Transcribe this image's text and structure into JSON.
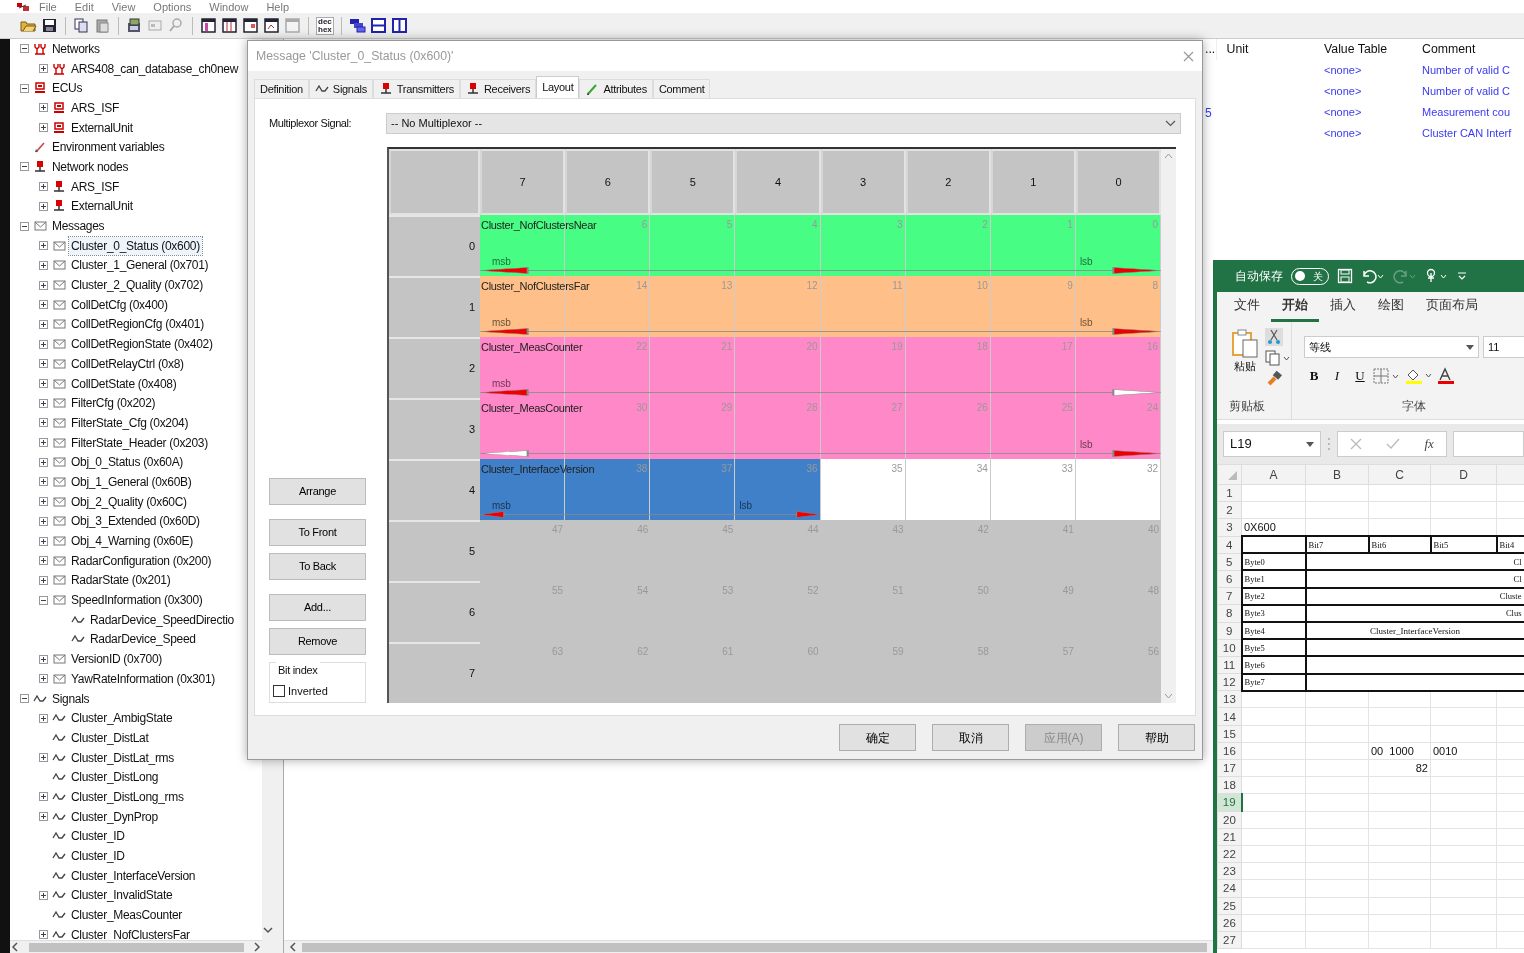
{
  "menu": [
    "File",
    "Edit",
    "View",
    "Options",
    "Window",
    "Help"
  ],
  "toolbar": {
    "format_toggle": [
      "dec",
      "hex"
    ]
  },
  "tree": [
    {
      "label": "Networks",
      "kind": "network",
      "expanded": true,
      "selected": false,
      "children": [
        {
          "label": "ARS408_can_database_ch0new",
          "kind": "network",
          "expanded": false,
          "selected": false
        }
      ]
    },
    {
      "label": "ECUs",
      "kind": "ecu",
      "expanded": true,
      "selected": false,
      "children": [
        {
          "label": "ARS_ISF",
          "kind": "ecu",
          "expanded": false,
          "selected": false
        },
        {
          "label": "ExternalUnit",
          "kind": "ecu",
          "expanded": false,
          "selected": false
        }
      ]
    },
    {
      "label": "Environment variables",
      "kind": "env",
      "selected": false
    },
    {
      "label": "Network nodes",
      "kind": "node",
      "expanded": true,
      "selected": false,
      "children": [
        {
          "label": "ARS_ISF",
          "kind": "node",
          "expanded": false,
          "selected": false
        },
        {
          "label": "ExternalUnit",
          "kind": "node",
          "expanded": false,
          "selected": false
        }
      ]
    },
    {
      "label": "Messages",
      "kind": "message",
      "expanded": true,
      "selected": false,
      "children": [
        {
          "label": "Cluster_0_Status (0x600)",
          "kind": "message",
          "expanded": false,
          "selected": true
        },
        {
          "label": "Cluster_1_General (0x701)",
          "kind": "message",
          "expanded": false,
          "selected": false
        },
        {
          "label": "Cluster_2_Quality (0x702)",
          "kind": "message",
          "expanded": false,
          "selected": false
        },
        {
          "label": "CollDetCfg (0x400)",
          "kind": "message",
          "expanded": false,
          "selected": false
        },
        {
          "label": "CollDetRegionCfg (0x401)",
          "kind": "message",
          "expanded": false,
          "selected": false
        },
        {
          "label": "CollDetRegionState (0x402)",
          "kind": "message",
          "expanded": false,
          "selected": false
        },
        {
          "label": "CollDetRelayCtrl (0x8)",
          "kind": "message",
          "expanded": false,
          "selected": false
        },
        {
          "label": "CollDetState (0x408)",
          "kind": "message",
          "expanded": false,
          "selected": false
        },
        {
          "label": "FilterCfg (0x202)",
          "kind": "message",
          "expanded": false,
          "selected": false
        },
        {
          "label": "FilterState_Cfg (0x204)",
          "kind": "message",
          "expanded": false,
          "selected": false
        },
        {
          "label": "FilterState_Header (0x203)",
          "kind": "message",
          "expanded": false,
          "selected": false
        },
        {
          "label": "Obj_0_Status (0x60A)",
          "kind": "message",
          "expanded": false,
          "selected": false
        },
        {
          "label": "Obj_1_General (0x60B)",
          "kind": "message",
          "expanded": false,
          "selected": false
        },
        {
          "label": "Obj_2_Quality (0x60C)",
          "kind": "message",
          "expanded": false,
          "selected": false
        },
        {
          "label": "Obj_3_Extended (0x60D)",
          "kind": "message",
          "expanded": false,
          "selected": false
        },
        {
          "label": "Obj_4_Warning (0x60E)",
          "kind": "message",
          "expanded": false,
          "selected": false
        },
        {
          "label": "RadarConfiguration (0x200)",
          "kind": "message",
          "expanded": false,
          "selected": false
        },
        {
          "label": "RadarState (0x201)",
          "kind": "message",
          "expanded": false,
          "selected": false
        },
        {
          "label": "SpeedInformation (0x300)",
          "kind": "message",
          "expanded": true,
          "selected": false,
          "children": [
            {
              "label": "RadarDevice_SpeedDirectio",
              "kind": "signal",
              "selected": false
            },
            {
              "label": "RadarDevice_Speed",
              "kind": "signal",
              "selected": false
            }
          ]
        },
        {
          "label": "VersionID (0x700)",
          "kind": "message",
          "expanded": false,
          "selected": false
        },
        {
          "label": "YawRateInformation (0x301)",
          "kind": "message",
          "expanded": false,
          "selected": false
        }
      ]
    },
    {
      "label": "Signals",
      "kind": "signal",
      "expanded": true,
      "selected": false,
      "children": [
        {
          "label": "Cluster_AmbigState",
          "kind": "signal",
          "expanded": false,
          "selected": false
        },
        {
          "label": "Cluster_DistLat",
          "kind": "signal",
          "selected": false
        },
        {
          "label": "Cluster_DistLat_rms",
          "kind": "signal",
          "expanded": false,
          "selected": false
        },
        {
          "label": "Cluster_DistLong",
          "kind": "signal",
          "selected": false
        },
        {
          "label": "Cluster_DistLong_rms",
          "kind": "signal",
          "expanded": false,
          "selected": false
        },
        {
          "label": "Cluster_DynProp",
          "kind": "signal",
          "expanded": false,
          "selected": false
        },
        {
          "label": "Cluster_ID",
          "kind": "signal",
          "selected": false
        },
        {
          "label": "Cluster_ID",
          "kind": "signal",
          "selected": false
        },
        {
          "label": "Cluster_InterfaceVersion",
          "kind": "signal",
          "selected": false
        },
        {
          "label": "Cluster_InvalidState",
          "kind": "signal",
          "expanded": false,
          "selected": false
        },
        {
          "label": "Cluster_MeasCounter",
          "kind": "signal",
          "selected": false
        },
        {
          "label": "Cluster_NofClustersFar",
          "kind": "signal",
          "expanded": false,
          "selected": false
        }
      ]
    }
  ],
  "signal_list": {
    "columns": [
      "...",
      "Unit",
      "Value Table",
      "Comment"
    ],
    "rows": [
      {
        "value_table": "<none>",
        "comment": "Number of valid C"
      },
      {
        "value_table": "<none>",
        "comment": "Number of valid C"
      },
      {
        "column_1": "5",
        "value_table": "<none>",
        "comment": "Measurement cou"
      },
      {
        "value_table": "<none>",
        "comment": "Cluster CAN Interf"
      }
    ]
  },
  "dialog": {
    "title": "Message 'Cluster_0_Status (0x600)'",
    "tabs": [
      {
        "label": "Definition",
        "kind": "plain",
        "selected": false
      },
      {
        "label": "Signals",
        "kind": "signal",
        "selected": false
      },
      {
        "label": "Transmitters",
        "kind": "node",
        "selected": false
      },
      {
        "label": "Receivers",
        "kind": "node",
        "selected": false
      },
      {
        "label": "Layout",
        "kind": "plain",
        "selected": true
      },
      {
        "label": "Attributes",
        "kind": "attribute",
        "selected": false
      },
      {
        "label": "Comment",
        "kind": "plain",
        "selected": false
      }
    ],
    "multiplexor": {
      "label": "Multiplexor Signal:",
      "value": "-- No Multiplexor --"
    },
    "side_buttons": [
      "Arrange",
      "To Front",
      "To Back",
      "Add...",
      "Remove"
    ],
    "bit_index": {
      "title": "Bit index",
      "label": "Inverted",
      "checked": false
    },
    "bit_layout": {
      "columns": [
        "7",
        "6",
        "5",
        "4",
        "3",
        "2",
        "1",
        "0"
      ],
      "rows": [
        {
          "byte": "0",
          "segment": {
            "name": "Cluster_NofClustersNear",
            "color": "#47fd84",
            "msb": true,
            "msb_text": "msb",
            "lsb": true,
            "lsb_text": "lsb"
          },
          "cells": [
            {
              "in_signal": true
            },
            {
              "bit": "6",
              "in_signal": true
            },
            {
              "bit": "5",
              "in_signal": true
            },
            {
              "bit": "4",
              "in_signal": true
            },
            {
              "bit": "3",
              "in_signal": true
            },
            {
              "bit": "2",
              "in_signal": true
            },
            {
              "bit": "1",
              "in_signal": true
            },
            {
              "bit": "0",
              "in_signal": true
            }
          ]
        },
        {
          "byte": "1",
          "segment": {
            "name": "Cluster_NofClustersFar",
            "color": "#fec088",
            "msb": true,
            "msb_text": "msb",
            "lsb": true,
            "lsb_text": "lsb"
          },
          "cells": [
            {
              "in_signal": true
            },
            {
              "bit": "14",
              "in_signal": true
            },
            {
              "bit": "13",
              "in_signal": true
            },
            {
              "bit": "12",
              "in_signal": true
            },
            {
              "bit": "11",
              "in_signal": true
            },
            {
              "bit": "10",
              "in_signal": true
            },
            {
              "bit": "9",
              "in_signal": true
            },
            {
              "bit": "8",
              "in_signal": true
            }
          ]
        },
        {
          "byte": "2",
          "segment": {
            "name": "Cluster_MeasCounter",
            "color": "#ff88c8",
            "msb": true,
            "msb_text": "msb",
            "lsb": false
          },
          "cells": [
            {
              "in_signal": true
            },
            {
              "bit": "22",
              "in_signal": true
            },
            {
              "bit": "21",
              "in_signal": true
            },
            {
              "bit": "20",
              "in_signal": true
            },
            {
              "bit": "19",
              "in_signal": true
            },
            {
              "bit": "18",
              "in_signal": true
            },
            {
              "bit": "17",
              "in_signal": true
            },
            {
              "bit": "16",
              "in_signal": true
            }
          ]
        },
        {
          "byte": "3",
          "segment": {
            "name": "Cluster_MeasCounter",
            "color": "#ff88c8",
            "msb": false,
            "lsb": true,
            "lsb_text": "lsb"
          },
          "cells": [
            {
              "in_signal": true
            },
            {
              "bit": "30",
              "in_signal": true
            },
            {
              "bit": "29",
              "in_signal": true
            },
            {
              "bit": "28",
              "in_signal": true
            },
            {
              "bit": "27",
              "in_signal": true
            },
            {
              "bit": "26",
              "in_signal": true
            },
            {
              "bit": "25",
              "in_signal": true
            },
            {
              "bit": "24",
              "in_signal": true
            }
          ]
        },
        {
          "byte": "4",
          "used": true,
          "segment": {
            "name": "Cluster_InterfaceVersion",
            "color": "#4080c8",
            "msb": true,
            "msb_text": "msb",
            "lsb": true,
            "lsb_text": "lsb"
          },
          "cells": [
            {
              "in_signal": true
            },
            {
              "bit": "38",
              "in_signal": true
            },
            {
              "bit": "37",
              "in_signal": true
            },
            {
              "bit": "36",
              "in_signal": true
            },
            {
              "bit": "35",
              "in_signal": false
            },
            {
              "bit": "34",
              "in_signal": false
            },
            {
              "bit": "33",
              "in_signal": false
            },
            {
              "bit": "32",
              "in_signal": false
            }
          ]
        },
        {
          "byte": "5",
          "used": false,
          "cells": [
            {
              "bit": "47",
              "in_signal": false
            },
            {
              "bit": "46",
              "in_signal": false
            },
            {
              "bit": "45",
              "in_signal": false
            },
            {
              "bit": "44",
              "in_signal": false
            },
            {
              "bit": "43",
              "in_signal": false
            },
            {
              "bit": "42",
              "in_signal": false
            },
            {
              "bit": "41",
              "in_signal": false
            },
            {
              "bit": "40",
              "in_signal": false
            }
          ]
        },
        {
          "byte": "6",
          "used": false,
          "cells": [
            {
              "bit": "55",
              "in_signal": false
            },
            {
              "bit": "54",
              "in_signal": false
            },
            {
              "bit": "53",
              "in_signal": false
            },
            {
              "bit": "52",
              "in_signal": false
            },
            {
              "bit": "51",
              "in_signal": false
            },
            {
              "bit": "50",
              "in_signal": false
            },
            {
              "bit": "49",
              "in_signal": false
            },
            {
              "bit": "48",
              "in_signal": false
            }
          ]
        },
        {
          "byte": "7",
          "used": false,
          "cells": [
            {
              "bit": "63",
              "in_signal": false
            },
            {
              "bit": "62",
              "in_signal": false
            },
            {
              "bit": "61",
              "in_signal": false
            },
            {
              "bit": "60",
              "in_signal": false
            },
            {
              "bit": "59",
              "in_signal": false
            },
            {
              "bit": "58",
              "in_signal": false
            },
            {
              "bit": "57",
              "in_signal": false
            },
            {
              "bit": "56",
              "in_signal": false
            }
          ]
        }
      ]
    },
    "footer_buttons": [
      {
        "label": "确定",
        "disabled": false
      },
      {
        "label": "取消",
        "disabled": false
      },
      {
        "label": "应用(A)",
        "disabled": true
      },
      {
        "label": "帮助",
        "disabled": false
      }
    ]
  },
  "excel": {
    "autosave": {
      "label": "自动保存",
      "on": false,
      "state_text": "关"
    },
    "tabs": [
      {
        "label": "文件",
        "selected": false
      },
      {
        "label": "开始",
        "selected": true
      },
      {
        "label": "插入",
        "selected": false
      },
      {
        "label": "绘图",
        "selected": false
      },
      {
        "label": "页面布局",
        "selected": false
      }
    ],
    "paste_label": "粘贴",
    "clipboard_label": "剪贴板",
    "font_name": "等线",
    "font_size": "11",
    "format_buttons": [
      "B",
      "I",
      "U"
    ],
    "font_label": "字体",
    "name_box": "L19",
    "fx": "fx",
    "columns": [
      "A",
      "B",
      "C",
      "D"
    ],
    "rows": [
      {
        "header": "1",
        "selected": false
      },
      {
        "header": "2",
        "selected": false
      },
      {
        "header": "3",
        "selected": false,
        "cells": {
          "A": "0X600"
        }
      },
      {
        "header": "4",
        "selected": false,
        "framed": true,
        "cells": {
          "B": "Bit7",
          "C": "Bit6",
          "D": "Bit5",
          "E": "Bit4"
        }
      },
      {
        "header": "5",
        "selected": false,
        "framed": true,
        "cells": {
          "A": "Byte0"
        },
        "merged": {
          "text": "Cl",
          "kind": "right"
        }
      },
      {
        "header": "6",
        "selected": false,
        "framed": true,
        "cells": {
          "A": "Byte1"
        },
        "merged": {
          "text": "Cl",
          "kind": "right"
        }
      },
      {
        "header": "7",
        "selected": false,
        "framed": true,
        "cells": {
          "A": "Byte2"
        },
        "merged": {
          "text": "Cluste",
          "kind": "right"
        }
      },
      {
        "header": "8",
        "selected": false,
        "framed": true,
        "cells": {
          "A": "Byte3"
        },
        "merged": {
          "text": "Clus",
          "kind": "right"
        }
      },
      {
        "header": "9",
        "selected": false,
        "framed": true,
        "cells": {
          "A": "Byte4"
        },
        "centered": {
          "text": "Cluster_InterfaceVersion"
        }
      },
      {
        "header": "10",
        "selected": false,
        "framed": true,
        "cells": {
          "A": "Byte5"
        },
        "merged": {
          "kind": "right"
        }
      },
      {
        "header": "11",
        "selected": false,
        "framed": true,
        "cells": {
          "A": "Byte6"
        },
        "merged": {
          "kind": "right"
        }
      },
      {
        "header": "12",
        "selected": false,
        "framed": true,
        "cells": {
          "A": "Byte7"
        },
        "merged": {
          "kind": "right"
        }
      },
      {
        "header": "13",
        "selected": false
      },
      {
        "header": "14",
        "selected": false
      },
      {
        "header": "15",
        "selected": false
      },
      {
        "header": "16",
        "selected": false,
        "cells": {
          "C": "00  1000",
          "D": "0010"
        }
      },
      {
        "header": "17",
        "selected": false,
        "numbers": {
          "C": "82"
        }
      },
      {
        "header": "18",
        "selected": false
      },
      {
        "header": "19",
        "selected": true
      },
      {
        "header": "20",
        "selected": false
      },
      {
        "header": "21",
        "selected": false
      },
      {
        "header": "22",
        "selected": false
      },
      {
        "header": "23",
        "selected": false
      },
      {
        "header": "24",
        "selected": false
      },
      {
        "header": "25",
        "selected": false
      },
      {
        "header": "26",
        "selected": false
      },
      {
        "header": "27",
        "selected": false
      }
    ]
  }
}
